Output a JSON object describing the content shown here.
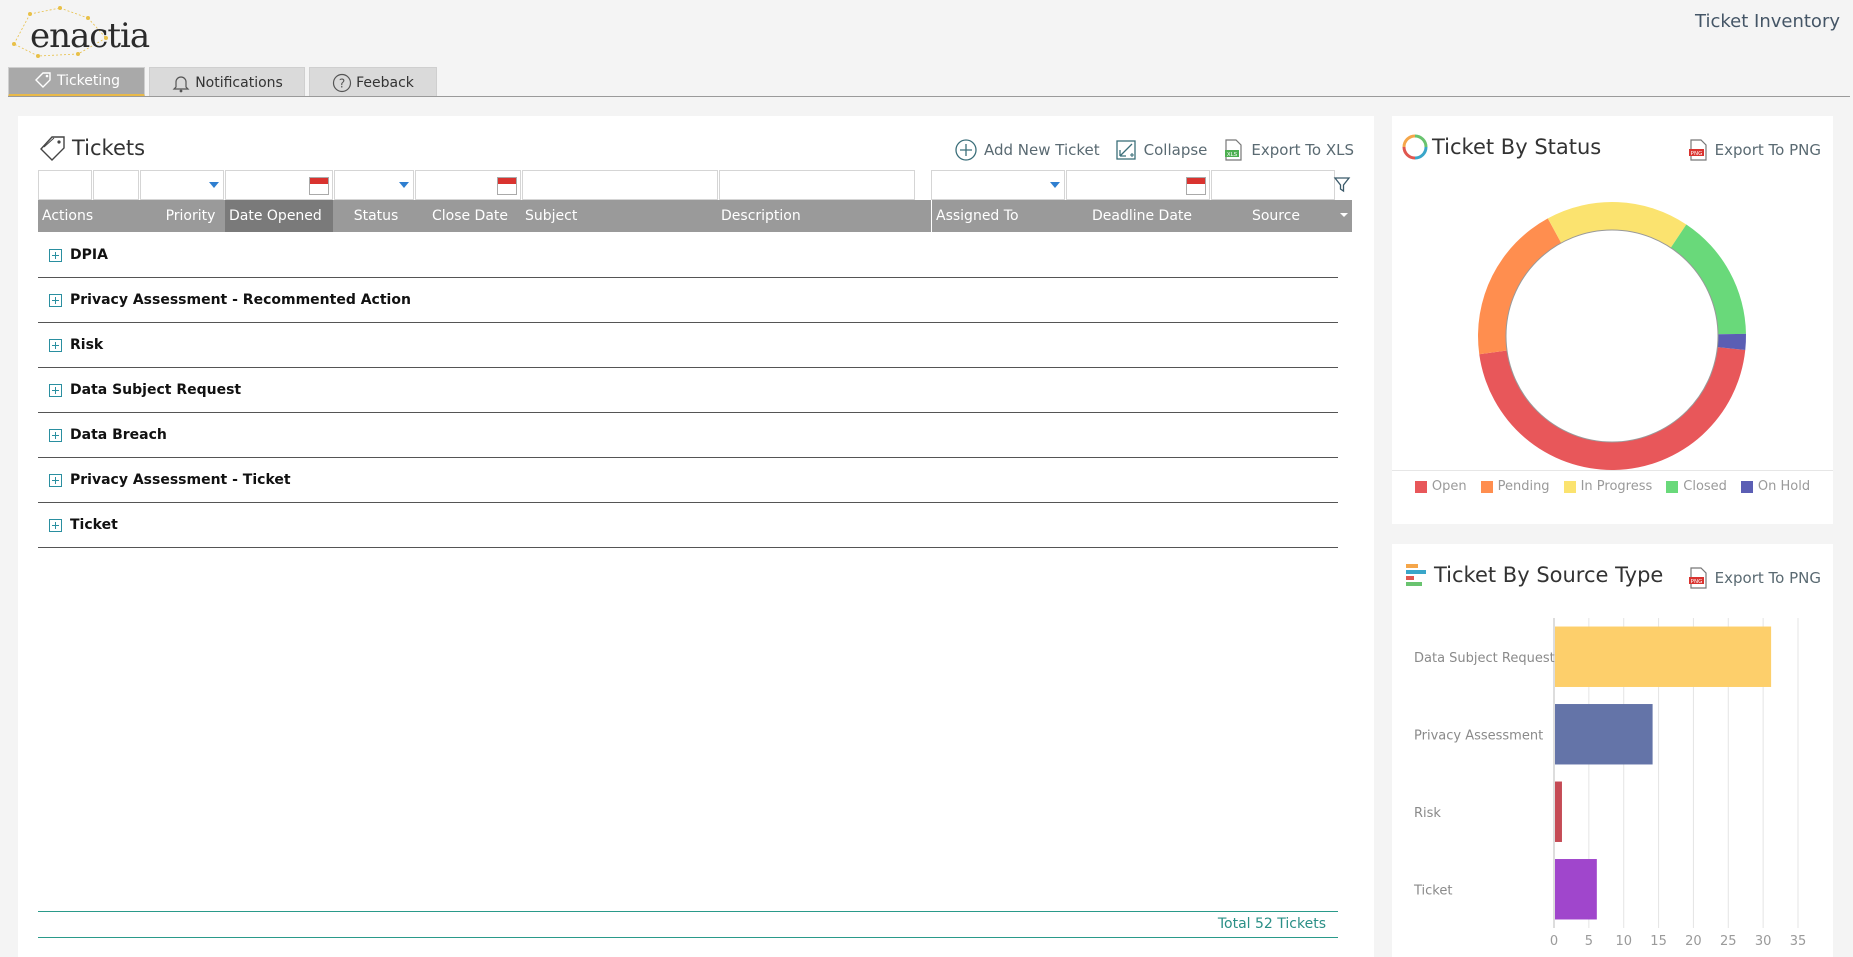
{
  "header": {
    "logo_text": "enactia",
    "page_title": "Ticket Inventory"
  },
  "tabs": [
    {
      "label": "Ticketing",
      "icon": "ticket-icon",
      "active": true
    },
    {
      "label": "Notifications",
      "icon": "bell-icon",
      "active": false
    },
    {
      "label": "Feeback",
      "icon": "help-icon",
      "active": false
    }
  ],
  "tickets": {
    "title": "Tickets",
    "toolbar": {
      "add_label": "Add New Ticket",
      "collapse_label": "Collapse",
      "export_label": "Export To XLS"
    },
    "columns": [
      "Actions",
      "Priority",
      "Date Opened",
      "Status",
      "Close Date",
      "Subject",
      "Description",
      "Assigned To",
      "Deadline Date",
      "Source"
    ],
    "sorted_column": "Date Opened",
    "groups": [
      "DPIA",
      "Privacy Assessment - Recommented Action",
      "Risk",
      "Data Subject Request",
      "Data Breach",
      "Privacy Assessment - Ticket",
      "Ticket"
    ],
    "total_label": "Total 52 Tickets"
  },
  "status_chart": {
    "title": "Ticket By Status",
    "export_label": "Export To PNG",
    "chart_data": {
      "type": "pie",
      "categories": [
        "Open",
        "Pending",
        "In Progress",
        "Closed",
        "On Hold"
      ],
      "values": [
        24,
        10,
        9,
        8,
        1
      ],
      "colors": [
        "#e8575a",
        "#ff8e4f",
        "#fbe36f",
        "#69d97a",
        "#5b5eb4"
      ]
    }
  },
  "source_chart": {
    "title": "Ticket By Source Type",
    "export_label": "Export To PNG",
    "chart_data": {
      "type": "bar",
      "orientation": "horizontal",
      "categories": [
        "Data Subject Request",
        "Privacy Assessment",
        "Risk",
        "Ticket"
      ],
      "values": [
        31,
        14,
        1,
        6
      ],
      "colors": [
        "#fdcf6b",
        "#6474a8",
        "#c54b55",
        "#a046cc"
      ],
      "xlim": [
        0,
        35
      ],
      "xticks": [
        0,
        5,
        10,
        15,
        20,
        25,
        30,
        35
      ],
      "grid": true
    }
  }
}
